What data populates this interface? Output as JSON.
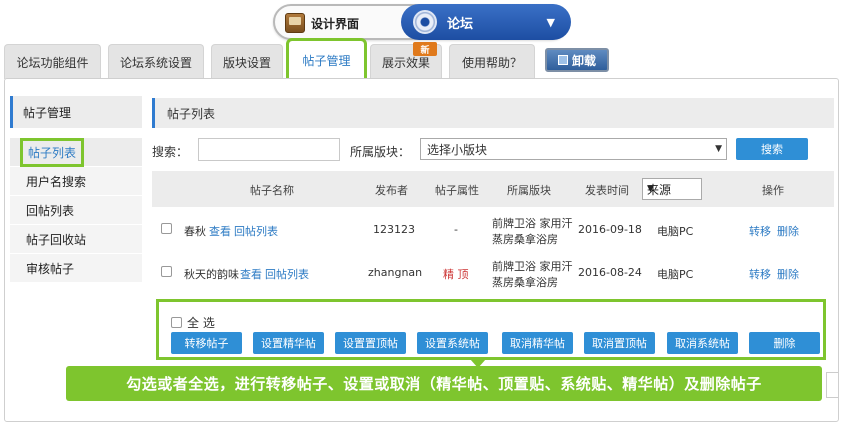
{
  "switcher": {
    "left_label": "设计界面",
    "right_label": "论坛",
    "caret": "▼"
  },
  "tabs": [
    {
      "label": "论坛功能组件"
    },
    {
      "label": "论坛系统设置"
    },
    {
      "label": "版块设置"
    },
    {
      "label": "帖子管理",
      "active": true
    },
    {
      "label": "展示效果"
    },
    {
      "label": "使用帮助？"
    }
  ],
  "new_badge": "新",
  "uninstall_label": "卸载",
  "sidebar": {
    "title": "帖子管理",
    "items": [
      {
        "label": "帖子列表",
        "active": true
      },
      {
        "label": "用户名搜索"
      },
      {
        "label": "回帖列表"
      },
      {
        "label": "帖子回收站"
      },
      {
        "label": "审核帖子"
      }
    ]
  },
  "content": {
    "title": "帖子列表",
    "search_label": "搜索：",
    "search_value": "",
    "board_label": "所属版块：",
    "board_select": "选择小版块",
    "search_button": "搜索"
  },
  "table": {
    "headers": {
      "name": "帖子名称",
      "author": "发布者",
      "attr": "帖子属性",
      "board": "所属版块",
      "time": "发表时间",
      "source": "来源",
      "ops": "操作"
    },
    "rows": [
      {
        "title": "春秋",
        "view": "查看",
        "replies": "回帖列表",
        "author": "123123",
        "attr": "-",
        "board_line1": "前牌卫浴 家用汗",
        "board_line2": "蒸房桑拿浴房",
        "time": "2016-09-18",
        "source": "电脑PC",
        "move": "转移",
        "delete": "删除"
      },
      {
        "title": "秋天的韵味",
        "view": "查看",
        "replies": "回帖列表",
        "author": "zhangnan",
        "attr": "精 顶",
        "board_line1": "前牌卫浴 家用汗",
        "board_line2": "蒸房桑拿浴房",
        "time": "2016-08-24",
        "source": "电脑PC",
        "move": "转移",
        "delete": "删除"
      }
    ]
  },
  "actions": {
    "select_all": "全 选",
    "buttons": [
      "转移帖子",
      "设置精华帖",
      "设置置顶帖",
      "设置系统帖",
      "取消精华帖",
      "取消置顶帖",
      "取消系统帖",
      "删除"
    ]
  },
  "caption": "勾选或者全选，进行转移帖子、设置或取消（精华帖、顶置贴、系统贴、精华帖）及删除帖子",
  "colors": {
    "accent_green": "#7ec52e",
    "primary_blue": "#2f8fd6",
    "link_blue": "#2d7bc4",
    "attr_red": "#cc3333"
  }
}
